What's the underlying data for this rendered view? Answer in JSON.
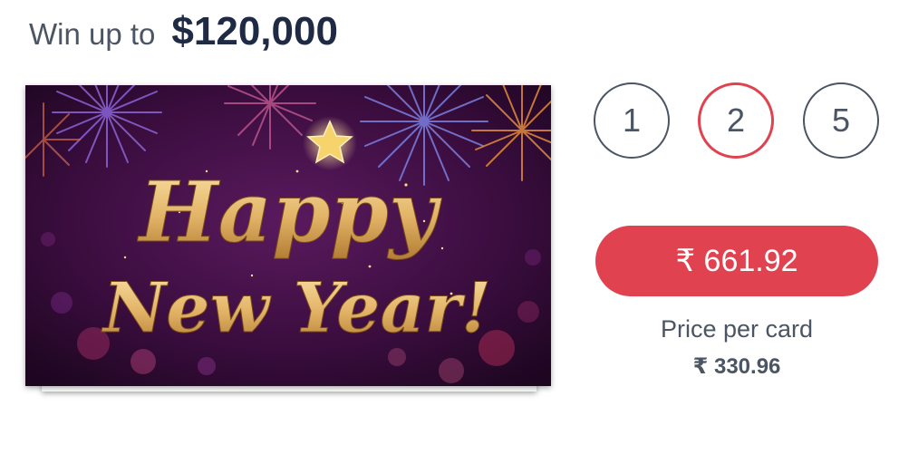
{
  "header": {
    "prefix": "Win up to",
    "amount": "$120,000"
  },
  "card": {
    "line1": "Happy",
    "line2": "New Year!",
    "colors": {
      "background": "#3a0d3e",
      "gold": "#e9c27a",
      "star": "#f6d36b"
    }
  },
  "quantity": {
    "options": [
      "1",
      "2",
      "5"
    ],
    "selected": "2",
    "selected_color": "#e0424f"
  },
  "purchase": {
    "button_label": "₹ 661.92",
    "price_per_card_label": "Price per card",
    "price_per_card_value": "₹ 330.96"
  }
}
